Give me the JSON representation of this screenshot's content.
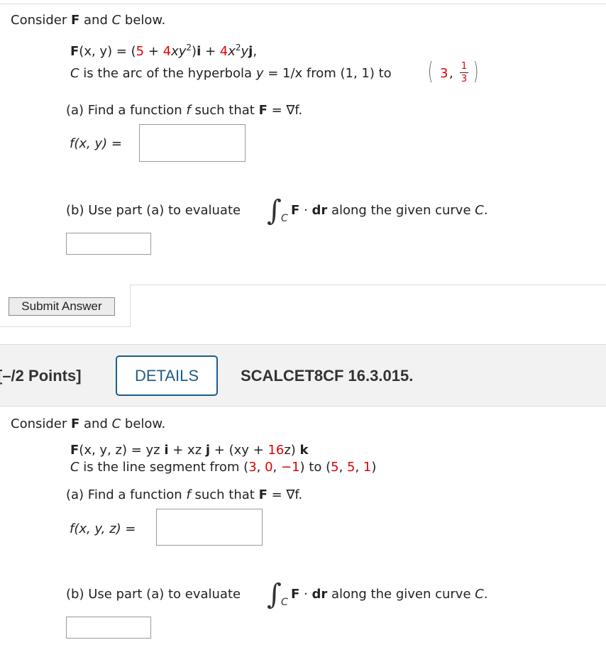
{
  "q1": {
    "intro_pre": "Consider ",
    "intro_F": "F",
    "intro_and": " and ",
    "intro_C": "C",
    "intro_post": " below.",
    "F_lhs": "F",
    "F_args": "(x, y) = (",
    "F_t1": "5",
    "F_plus1": " + ",
    "F_t2": "4",
    "F_t2b": "xy",
    "F_sup1": "2",
    "F_close": ")",
    "F_i": "i",
    "F_plus2": " + ",
    "F_t3": "4",
    "F_t3b": "x",
    "F_sup2": "2",
    "F_t3c": "y",
    "F_j": "j",
    "F_comma": ",",
    "C_line_pre": "C",
    "C_line_mid": " is the arc of the hyperbola ",
    "C_line_y": "y",
    "C_line_eq": " = 1/x from (1, 1) to ",
    "C_pt_x": "3",
    "C_pt_comma": ",",
    "C_pt_num": "1",
    "C_pt_den": "3",
    "a_text_pre": "(a) Find a function ",
    "a_text_f": "f",
    "a_text_mid": " such that ",
    "a_text_F": "F",
    "a_text_post": " = ∇f.",
    "f_label": "f(x, y) =",
    "b_text": "(b) Use part (a) to evaluate",
    "int_sub": "C",
    "b_after_F": "F",
    "b_after_dot": " · ",
    "b_after_dr": "dr",
    "b_after_post": "  along the given curve ",
    "b_after_C": "C",
    "b_after_period": "."
  },
  "submit_label": "Submit Answer",
  "q2_header": {
    "points": "[–/2 Points]",
    "details_label": "DETAILS",
    "question_id": "SCALCET8CF 16.3.015."
  },
  "q2": {
    "intro_pre": "Consider ",
    "intro_F": "F",
    "intro_and": " and ",
    "intro_C": "C",
    "intro_post": " below.",
    "F_lhs": "F",
    "F_args": "(x, y, z) = yz ",
    "F_i": "i",
    "F_mid1": " + xz ",
    "F_j": "j",
    "F_mid2": " + (xy + ",
    "F_red": "16",
    "F_z": "z) ",
    "F_k": "k",
    "C_pre": "C",
    "C_mid": " is the line segment from (",
    "C_a1": "3",
    "C_c1": ", ",
    "C_a2": "0",
    "C_c2": ", ",
    "C_a3": "−1",
    "C_mid2": ") to (",
    "C_b1": "5",
    "C_c3": ", ",
    "C_b2": "5",
    "C_c4": ", ",
    "C_b3": "1",
    "C_end": ")",
    "a_text_pre": "(a) Find a function ",
    "a_text_f": "f",
    "a_text_mid": " such that ",
    "a_text_F": "F",
    "a_text_post": " = ∇f.",
    "f_label": "f(x, y, z) =",
    "b_text": "(b) Use part (a) to evaluate",
    "int_sub": "C",
    "b_after_F": "F",
    "b_after_dot": " · ",
    "b_after_dr": "dr",
    "b_after_post": "  along the given curve ",
    "b_after_C": "C",
    "b_after_period": "."
  },
  "colors": {
    "accent": "#1d5c8c",
    "highlight": "#e00000"
  }
}
